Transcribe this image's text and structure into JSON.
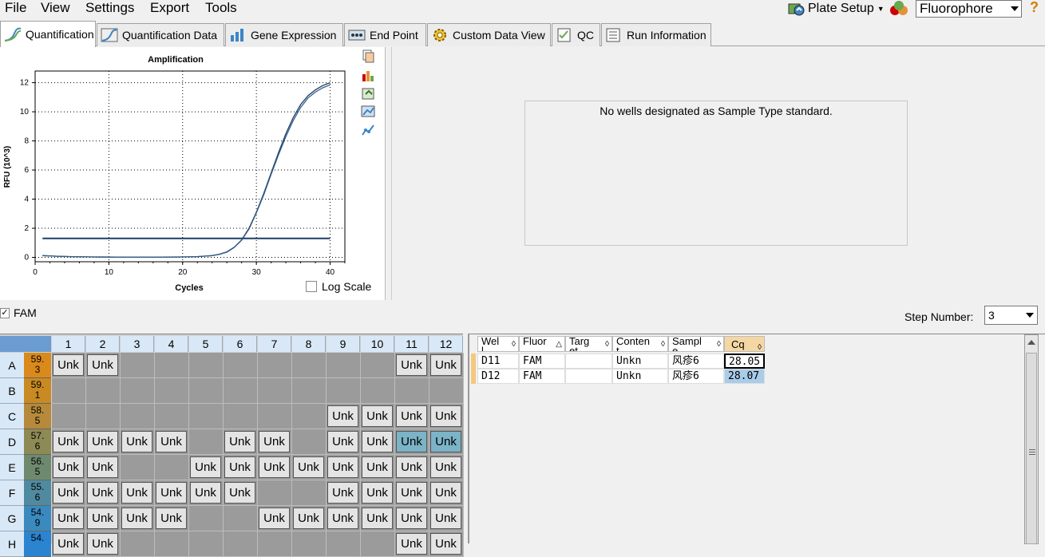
{
  "menu": {
    "items": [
      "File",
      "View",
      "Settings",
      "Export",
      "Tools"
    ]
  },
  "toolbar": {
    "plate_setup_label": "Plate Setup",
    "fluorophore_value": "Fluorophore",
    "help_label": "?"
  },
  "tabs": [
    {
      "label": "Quantification",
      "active": true
    },
    {
      "label": "Quantification Data"
    },
    {
      "label": "Gene Expression"
    },
    {
      "label": "End Point"
    },
    {
      "label": "Custom Data View"
    },
    {
      "label": "QC"
    },
    {
      "label": "Run Information"
    }
  ],
  "chart_data": {
    "type": "line",
    "title": "Amplification",
    "xlabel": "Cycles",
    "ylabel": "RFU (10^3)",
    "xlim": [
      0,
      42
    ],
    "ylim": [
      -0.3,
      12.8
    ],
    "xticks": [
      0,
      10,
      20,
      30,
      40
    ],
    "yticks": [
      0,
      2,
      4,
      6,
      8,
      10,
      12
    ],
    "grid": true,
    "threshold": 1.3,
    "series": [
      {
        "x": [
          1,
          3,
          5,
          8,
          11,
          14,
          17,
          20,
          22,
          24,
          25,
          26,
          27,
          28,
          29,
          30,
          31,
          32,
          33,
          34,
          35,
          36,
          37,
          38,
          39,
          40
        ],
        "y": [
          0.12,
          0.08,
          0.05,
          0.03,
          0.02,
          0.02,
          0.02,
          0.03,
          0.05,
          0.12,
          0.22,
          0.38,
          0.7,
          1.2,
          2.0,
          3.1,
          4.4,
          5.8,
          7.2,
          8.5,
          9.6,
          10.5,
          11.1,
          11.5,
          11.8,
          12.0
        ]
      },
      {
        "x": [
          1,
          3,
          5,
          8,
          11,
          14,
          17,
          20,
          22,
          24,
          25,
          26,
          27,
          28,
          29,
          30,
          31,
          32,
          33,
          34,
          35,
          36,
          37,
          38,
          39,
          40
        ],
        "y": [
          0.12,
          0.08,
          0.05,
          0.03,
          0.02,
          0.02,
          0.02,
          0.03,
          0.05,
          0.12,
          0.21,
          0.36,
          0.68,
          1.18,
          1.95,
          3.05,
          4.3,
          5.7,
          7.05,
          8.3,
          9.4,
          10.3,
          10.95,
          11.35,
          11.65,
          11.85
        ]
      }
    ]
  },
  "chart_options": {
    "log_scale_label": "Log Scale"
  },
  "standard_curve": {
    "message": "No wells designated as Sample Type standard."
  },
  "fluor_filter": {
    "label": "FAM",
    "checked": true
  },
  "step": {
    "label": "Step Number:",
    "value": "3"
  },
  "plate": {
    "columns": [
      "1",
      "2",
      "3",
      "4",
      "5",
      "6",
      "7",
      "8",
      "9",
      "10",
      "11",
      "12"
    ],
    "rows": [
      {
        "label": "A",
        "temp": "59.\n3",
        "wells": [
          "Unk",
          "Unk",
          "",
          "",
          "",
          "",
          "",
          "",
          "",
          "",
          "Unk",
          "Unk"
        ]
      },
      {
        "label": "B",
        "temp": "59.\n1",
        "wells": [
          "",
          "",
          "",
          "",
          "",
          "",
          "",
          "",
          "",
          "",
          "",
          ""
        ]
      },
      {
        "label": "C",
        "temp": "58.\n5",
        "wells": [
          "",
          "",
          "",
          "",
          "",
          "",
          "",
          "",
          "Unk",
          "Unk",
          "Unk",
          "Unk"
        ]
      },
      {
        "label": "D",
        "temp": "57.\n6",
        "wells": [
          "Unk",
          "Unk",
          "Unk",
          "Unk",
          "",
          "Unk",
          "Unk",
          "",
          "Unk",
          "Unk",
          "Unk*",
          "Unk*"
        ]
      },
      {
        "label": "E",
        "temp": "56.\n5",
        "wells": [
          "Unk",
          "Unk",
          "",
          "",
          "Unk",
          "Unk",
          "Unk",
          "Unk",
          "Unk",
          "Unk",
          "Unk",
          "Unk"
        ]
      },
      {
        "label": "F",
        "temp": "55.\n6",
        "wells": [
          "Unk",
          "Unk",
          "Unk",
          "Unk",
          "Unk",
          "Unk",
          "",
          "",
          "Unk",
          "Unk",
          "Unk",
          "Unk"
        ]
      },
      {
        "label": "G",
        "temp": "54.\n9",
        "wells": [
          "Unk",
          "Unk",
          "Unk",
          "Unk",
          "",
          "",
          "Unk",
          "Unk",
          "Unk",
          "Unk",
          "Unk",
          "Unk"
        ]
      },
      {
        "label": "H",
        "temp": "54.",
        "wells": [
          "Unk",
          "Unk",
          "",
          "",
          "",
          "",
          "",
          "",
          "",
          "",
          "Unk",
          "Unk"
        ]
      }
    ],
    "temp_colors": [
      "#d98a1a",
      "#c98a22",
      "#b68a3a",
      "#8e8a55",
      "#6e8a6e",
      "#508aa0",
      "#3a8ac0",
      "#2a84d0"
    ]
  },
  "results_table": {
    "headers": [
      "Wel\nl",
      "Fluor",
      "Targ\net",
      "Conten\nt",
      "Sampl\ne",
      "Cq"
    ],
    "rows": [
      [
        "D11",
        "FAM",
        "",
        "Unkn",
        "风疹6",
        "28.05"
      ],
      [
        "D12",
        "FAM",
        "",
        "Unkn",
        "风疹6",
        "28.07"
      ]
    ]
  }
}
